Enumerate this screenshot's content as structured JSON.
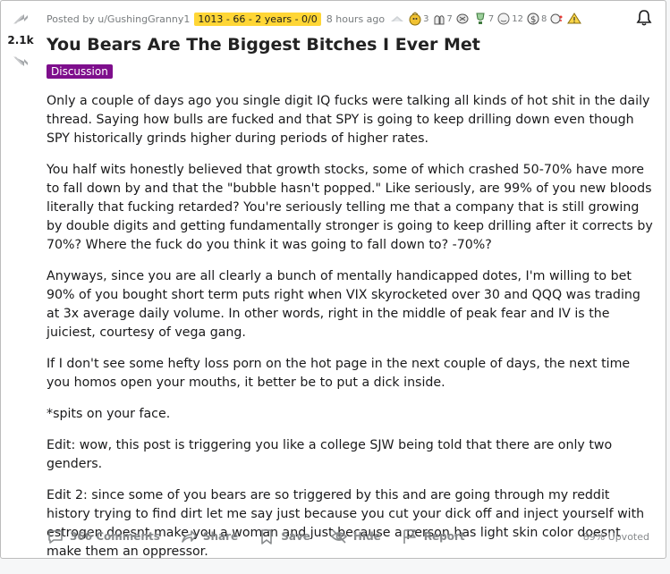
{
  "post": {
    "score": "2.1k",
    "posted_by": "Posted by u/GushingGranny1",
    "user_flair": "1013 - 66 - 2 years - 0/0",
    "time": "8 hours ago",
    "title": "You Bears Are The Biggest Bitches I Ever Met",
    "flair": "Discussion",
    "paragraphs": [
      "Only a couple of days ago you single digit IQ fucks were talking all kinds of hot shit in the daily thread. Saying how bulls are fucked and that SPY is going to keep drilling down even though SPY historically grinds higher during periods of higher rates.",
      "You half wits honestly believed that growth stocks, some of which crashed 50-70% have more to fall down by and that the \"bubble hasn't popped.\" Like seriously, are 99% of you new bloods literally that fucking retarded? You're seriously telling me that a company that is still growing by double digits and getting fundamentally stronger is going to keep drilling after it corrects by 70%? Where the fuck do you think it was going to fall down to? -70%?",
      "Anyways, since you are all clearly a bunch of mentally handicapped dotes, I'm willing to bet 90% of you bought short term puts right when VIX skyrocketed over 30 and QQQ was trading at 3x average daily volume. In other words, right in the middle of peak fear and IV is the juiciest, courtesy of vega gang.",
      "If I don't see some hefty loss porn on the hot page in the next couple of days, the next time you homos open your mouths, it better be to put a dick inside.",
      "*spits on your face.",
      "Edit: wow, this post is triggering you like a college SJW being told that there are only two genders.",
      "Edit 2: since some of you bears are so triggered by this and are going through my reddit history trying to find dirt let me say just because you cut your dick off and inject yourself with estrogen doesnt make you a woman and just because a person has light skin color doesnt make them an oppressor."
    ]
  },
  "awards": [
    {
      "icon": "silver-award-icon",
      "count": ""
    },
    {
      "icon": "gold-award-icon",
      "count": "3"
    },
    {
      "icon": "hands-award-icon",
      "count": "7"
    },
    {
      "icon": "brain-award-icon",
      "count": ""
    },
    {
      "icon": "trophy-award-icon",
      "count": "7"
    },
    {
      "icon": "face-award-icon",
      "count": "12"
    },
    {
      "icon": "dollar-award-icon",
      "count": "8"
    },
    {
      "icon": "spit-award-icon",
      "count": ""
    },
    {
      "icon": "warning-award-icon",
      "count": ""
    }
  ],
  "actions": {
    "comments": "366 Comments",
    "share": "Share",
    "save": "Save",
    "hide": "Hide",
    "report": "Report"
  },
  "upvoted": "89% Upvoted",
  "colors": {
    "flair_bg": "#7e0e8c",
    "user_flair_bg": "#ffd635",
    "muted_text": "#878a8c"
  }
}
